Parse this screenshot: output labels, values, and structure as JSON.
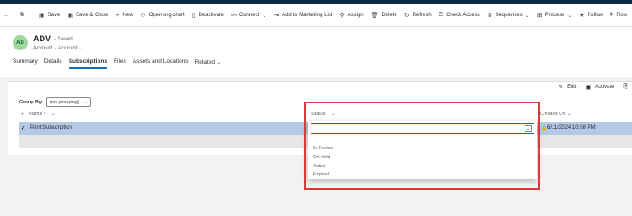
{
  "commands": [
    {
      "label": "",
      "icon": "←",
      "name": "back-button"
    },
    {
      "label": "",
      "icon": "⧉",
      "name": "popout-button"
    },
    {
      "label": "Save",
      "icon": "▣",
      "name": "save-button"
    },
    {
      "label": "Save & Close",
      "icon": "▣",
      "name": "save-close-button"
    },
    {
      "label": "New",
      "icon": "+",
      "name": "new-button"
    },
    {
      "label": "Open org chart",
      "icon": "⚇",
      "name": "org-chart-button"
    },
    {
      "label": "Deactivate",
      "icon": "▯",
      "name": "deactivate-button"
    },
    {
      "label": "Connect",
      "icon": "⚯",
      "name": "connect-button",
      "dropdown": true
    },
    {
      "label": "Add to Marketing List",
      "icon": "⇥",
      "name": "marketing-list-button"
    },
    {
      "label": "Assign",
      "icon": "⚲",
      "name": "assign-button"
    },
    {
      "label": "Delete",
      "icon": "🗑",
      "name": "delete-button"
    },
    {
      "label": "Refresh",
      "icon": "↻",
      "name": "refresh-button"
    },
    {
      "label": "Check Access",
      "icon": "⚿",
      "name": "check-access-button"
    },
    {
      "label": "Sequences",
      "icon": "⇕",
      "name": "sequences-button",
      "dropdown": true
    },
    {
      "label": "Process",
      "icon": "⊞",
      "name": "process-button",
      "dropdown": true
    },
    {
      "label": "Follow",
      "icon": "★",
      "name": "follow-button"
    },
    {
      "label": "Flow",
      "icon": "⏵",
      "name": "flow-button"
    }
  ],
  "record": {
    "initials": "AD",
    "title": "ADV",
    "saved": "- Saved",
    "entity": "Account",
    "form": "Account"
  },
  "tabs": [
    {
      "label": "Summary",
      "active": false
    },
    {
      "label": "Details",
      "active": false
    },
    {
      "label": "Subscriptions",
      "active": true
    },
    {
      "label": "Files",
      "active": false
    },
    {
      "label": "Assets and Locations",
      "active": false
    },
    {
      "label": "Related",
      "active": false,
      "dropdown": true
    }
  ],
  "grid": {
    "edit": "Edit",
    "activate": "Activate",
    "group_by_label": "Group By:",
    "group_by_value": "(no grouping)",
    "col_name": "Name ↑",
    "col_status": "Status",
    "col_created": "Created On",
    "row_name": "Print Subscription",
    "row_created": "6/11/2024 10:58 PM"
  },
  "status_options": [
    "In Review",
    "On Hold",
    "Active",
    "Expired"
  ]
}
